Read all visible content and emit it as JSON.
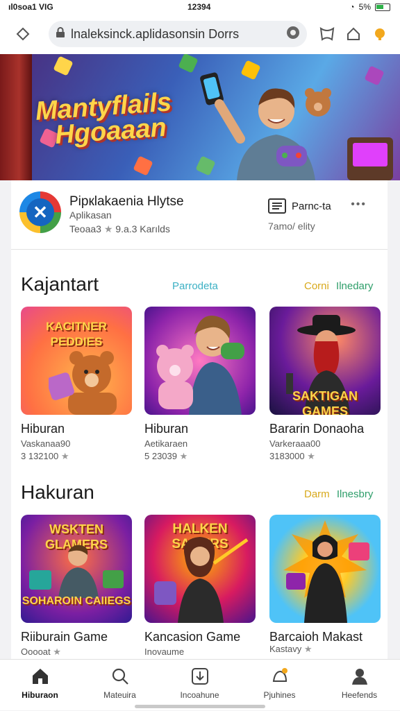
{
  "status_bar": {
    "left": "ıl0soa1 VIG",
    "time": "12394",
    "battery": "5%"
  },
  "browser": {
    "url": "lnaleksinck.aplidasonsin Dorrs"
  },
  "hero": {
    "title_line1": "Mantyflails",
    "title_line2": "Hgoaaan"
  },
  "app": {
    "name": "Ріркlаkaenia Hlytse",
    "subtitle": "Aplikasan",
    "meta_count": "Teoаа3",
    "meta_rating": "9.a.3 Karılds",
    "action_label": "Parnc-ta",
    "action_sub": "7amo/ elity"
  },
  "section1": {
    "title": "Kajantart",
    "link_mid": "Parrodeta",
    "link_right_1": "Corni",
    "link_right_2": "Ilnedary",
    "games": [
      {
        "tile_text": "KACITNER PEDDIES",
        "name": "Hiburan",
        "dev": "Vaskanaa90",
        "meta": "3 132100"
      },
      {
        "tile_text": "",
        "name": "Hiburan",
        "dev": "Aetikaraen",
        "meta": "5 23039"
      },
      {
        "tile_text": "SAKTIGAN GAMES",
        "name": "Bararin Donaoha",
        "dev": "Varkeraaa00",
        "meta": "3183000"
      }
    ]
  },
  "section2": {
    "title": "Hakuran",
    "link_right_1": "Darm",
    "link_right_2": "Ilnesbry",
    "games": [
      {
        "tile_text_top": "WSKTEN GLAMERS",
        "tile_text_bottom": "SOHAROIN CAIIEGS",
        "name": "Riiburain Game",
        "dev": "Ooooat"
      },
      {
        "tile_text_top": "HALKEN SAMERS",
        "tile_text_bottom": "",
        "name": "Kancasion Game",
        "dev": "Inovaume"
      },
      {
        "tile_text_top": "",
        "tile_text_bottom": "",
        "name": "Barcaioh Makast",
        "dev": "Kastavy"
      }
    ]
  },
  "bottom_nav": [
    {
      "label": "Hiburaon",
      "icon": "home-icon"
    },
    {
      "label": "Mateuira",
      "icon": "search-icon"
    },
    {
      "label": "Incoahune",
      "icon": "download-icon"
    },
    {
      "label": "Pjuhines",
      "icon": "notification-icon"
    },
    {
      "label": "Heefends",
      "icon": "profile-icon"
    }
  ],
  "colors": {
    "link_teal": "#3bb0c4",
    "link_yellow": "#d8a91c",
    "link_green": "#2e9e6a",
    "accent_orange": "#f2a81d"
  }
}
